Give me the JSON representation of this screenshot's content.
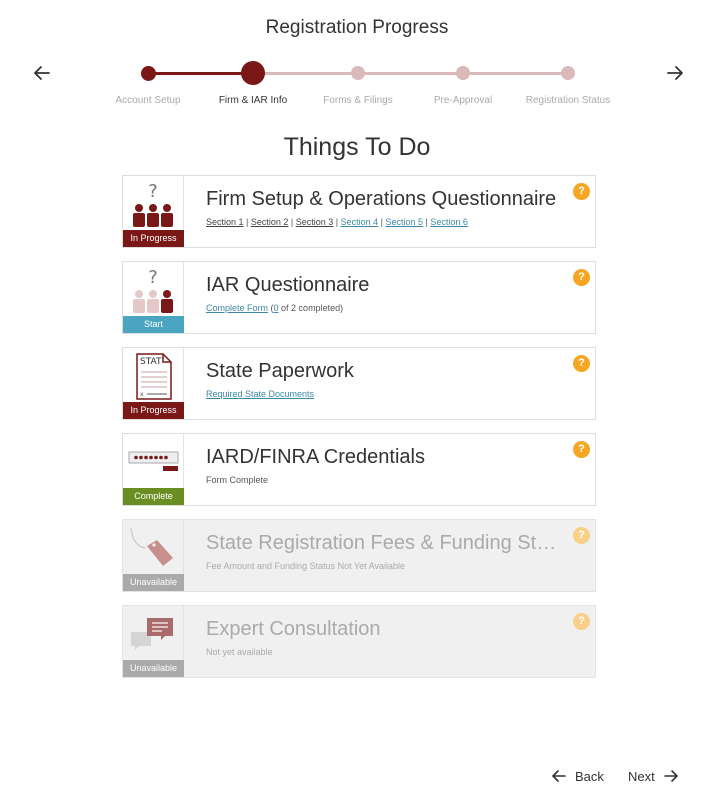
{
  "header": {
    "title": "Registration Progress"
  },
  "stepper": {
    "steps": [
      {
        "label": "Account Setup",
        "state": "done"
      },
      {
        "label": "Firm & IAR Info",
        "state": "current"
      },
      {
        "label": "Forms & Filings",
        "state": "todo"
      },
      {
        "label": "Pre-Approval",
        "state": "todo"
      },
      {
        "label": "Registration Status",
        "state": "todo"
      }
    ]
  },
  "main": {
    "title": "Things To Do",
    "cards": [
      {
        "title": "Firm Setup & Operations Questionnaire",
        "status": "In Progress",
        "icon": "people-question-icon",
        "links": [
          "Section 1",
          "Section 2",
          "Section 3",
          "Section 4",
          "Section 5",
          "Section 6"
        ]
      },
      {
        "title": "IAR Questionnaire",
        "status": "Start",
        "icon": "people-question-icon",
        "link": "Complete Form",
        "count": "0",
        "count_suffix": "of 2 completed)"
      },
      {
        "title": "State Paperwork",
        "status": "In Progress",
        "icon": "document-icon",
        "doc_label": "STAT",
        "link": "Required State Documents"
      },
      {
        "title": "IARD/FINRA Credentials",
        "status": "Complete",
        "icon": "password-icon",
        "text": "Form Complete"
      },
      {
        "title": "State Registration Fees & Funding Status",
        "status": "Unavailable",
        "icon": "price-tag-icon",
        "text": "Fee Amount and Funding Status Not Yet Available"
      },
      {
        "title": "Expert Consultation",
        "status": "Unavailable",
        "icon": "chat-icon",
        "text": "Not yet available"
      }
    ],
    "help_glyph": "?"
  },
  "footer": {
    "back_label": "Back",
    "next_label": "Next"
  },
  "colors": {
    "brand": "#7a1818",
    "start": "#4aa6c0",
    "complete": "#6b8e23",
    "help": "#f5a623",
    "link": "#3c88a6"
  }
}
